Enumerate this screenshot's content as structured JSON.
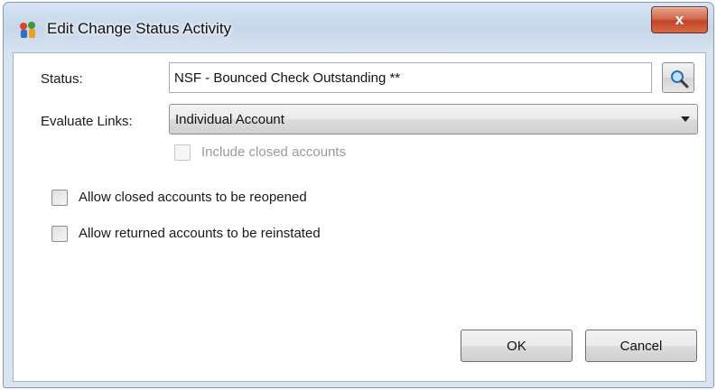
{
  "window": {
    "title": "Edit Change Status Activity",
    "close_label": "x"
  },
  "form": {
    "status_label": "Status:",
    "status_value": "NSF - Bounced Check Outstanding **",
    "evaluate_links_label": "Evaluate Links:",
    "evaluate_links_value": "Individual Account",
    "include_closed_label": "Include closed accounts",
    "include_closed_checked": false,
    "include_closed_enabled": false,
    "allow_reopen_label": "Allow closed accounts to be reopened",
    "allow_reopen_checked": false,
    "allow_reinstate_label": "Allow returned accounts to be reinstated",
    "allow_reinstate_checked": false
  },
  "buttons": {
    "ok_label": "OK",
    "cancel_label": "Cancel"
  },
  "icons": {
    "app": "app-icon",
    "search": "search-icon",
    "dropdown": "chevron-down-icon"
  }
}
